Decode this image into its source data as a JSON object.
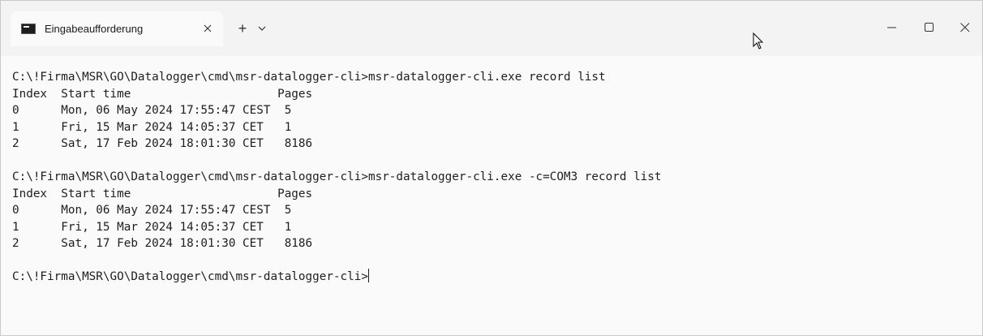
{
  "tab": {
    "title": "Eingabeaufforderung",
    "close_icon": "close-icon",
    "new_tab_label": "+",
    "dropdown_icon": "chevron-down-icon"
  },
  "window_controls": {
    "minimize_icon": "minimize-icon",
    "maximize_icon": "maximize-icon",
    "close_icon": "close-icon"
  },
  "console": {
    "lines": [
      "C:\\!Firma\\MSR\\GO\\Datalogger\\cmd\\msr-datalogger-cli>msr-datalogger-cli.exe record list",
      "Index  Start time                     Pages",
      "0      Mon, 06 May 2024 17:55:47 CEST  5",
      "1      Fri, 15 Mar 2024 14:05:37 CET   1",
      "2      Sat, 17 Feb 2024 18:01:30 CET   8186",
      "",
      "C:\\!Firma\\MSR\\GO\\Datalogger\\cmd\\msr-datalogger-cli>msr-datalogger-cli.exe -c=COM3 record list",
      "Index  Start time                     Pages",
      "0      Mon, 06 May 2024 17:55:47 CEST  5",
      "1      Fri, 15 Mar 2024 14:05:37 CET   1",
      "2      Sat, 17 Feb 2024 18:01:30 CET   8186",
      "",
      "C:\\!Firma\\MSR\\GO\\Datalogger\\cmd\\msr-datalogger-cli>"
    ]
  },
  "colors": {
    "titlebar_bg": "#f3f3f3",
    "console_bg": "#fafafa",
    "text": "#1e1e1e"
  }
}
